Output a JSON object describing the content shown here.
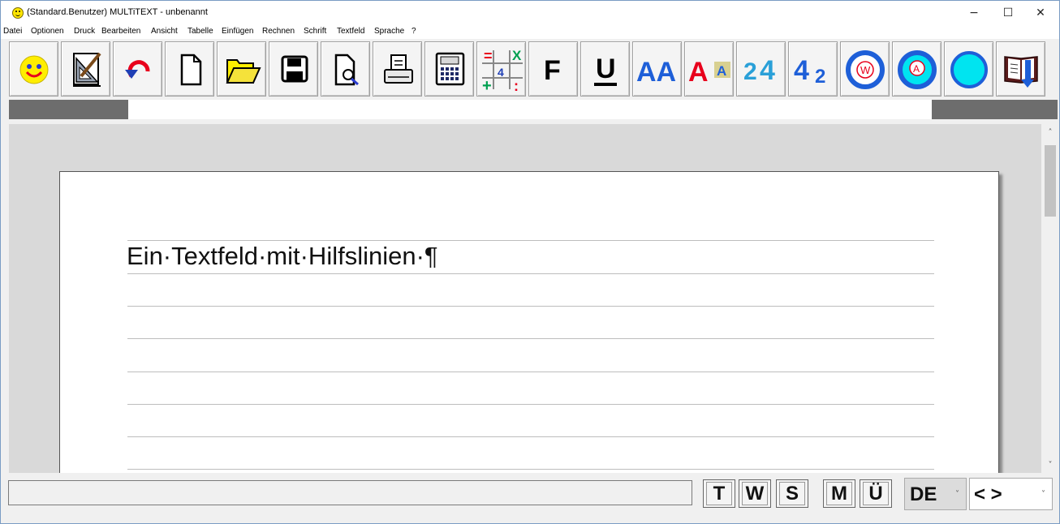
{
  "window": {
    "title": "(Standard.Benutzer) MULTiTEXT  -  unbenannt",
    "controls": {
      "minimize": "−",
      "maximize": "☐",
      "close": "✕"
    }
  },
  "menubar": {
    "items": [
      {
        "label": "Datei"
      },
      {
        "label": "Optionen"
      },
      {
        "label": "Druck"
      },
      {
        "label": "Bearbeiten"
      },
      {
        "label": "Ansicht"
      },
      {
        "label": "Tabelle"
      },
      {
        "label": "Einfügen"
      },
      {
        "label": "Rechnen"
      },
      {
        "label": "Schrift"
      },
      {
        "label": "Textfeld"
      },
      {
        "label": "Sprache"
      },
      {
        "label": "?"
      }
    ]
  },
  "toolbar": {
    "buttons": [
      {
        "icon": "smiley-icon"
      },
      {
        "icon": "drawing-tools-icon"
      },
      {
        "icon": "undo-icon"
      },
      {
        "icon": "new-document-icon"
      },
      {
        "icon": "open-folder-icon"
      },
      {
        "icon": "save-disk-icon"
      },
      {
        "icon": "print-preview-icon"
      },
      {
        "icon": "printer-icon"
      },
      {
        "icon": "calculator-icon"
      },
      {
        "icon": "math-operations-icon",
        "text": [
          "=",
          "4",
          "X",
          "+",
          ":"
        ]
      },
      {
        "icon": "font-letter-icon",
        "text": "F"
      },
      {
        "icon": "underline-icon",
        "text": "U"
      },
      {
        "icon": "font-size-aa-icon",
        "text": "AA"
      },
      {
        "icon": "font-highlight-aa-icon",
        "text": "AA"
      },
      {
        "icon": "superscript-icon",
        "text": "24"
      },
      {
        "icon": "subscript-icon",
        "text": "42"
      },
      {
        "icon": "circle-w-icon",
        "text": "W"
      },
      {
        "icon": "circle-a-icon",
        "text": "A"
      },
      {
        "icon": "circle-blue-icon"
      },
      {
        "icon": "book-download-icon"
      }
    ]
  },
  "document": {
    "paragraph": "Ein·Textfeld·mit·Hilfslinien·¶"
  },
  "statusbar": {
    "message": "",
    "keys": [
      "T",
      "W",
      "S",
      "M",
      "Ü"
    ],
    "language": "DE",
    "navigation": "< >"
  },
  "colors": {
    "toolbar_blue": "#1e5fd8",
    "toolbar_red": "#e8001c",
    "ruler_dark": "#6d6d6d",
    "workspace": "#d9d9d9"
  }
}
